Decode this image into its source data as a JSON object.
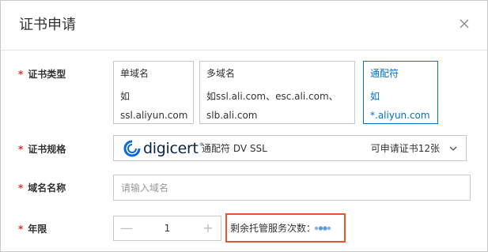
{
  "dialog": {
    "title": "证书申请",
    "close_icon": "close-icon"
  },
  "required_mark": "*",
  "cert_type": {
    "label": "证书类型",
    "options": [
      {
        "title": "单域名",
        "example": "如ssl.aliyun.com",
        "selected": false
      },
      {
        "title": "多域名",
        "example_line1": "如ssl.ali.com、esc.ali.com、",
        "example_line2": "slb.ali.com",
        "selected": false
      },
      {
        "title": "通配符",
        "example": "如*.aliyun.com",
        "selected": true
      }
    ]
  },
  "cert_spec": {
    "label": "证书规格",
    "brand": "digicert",
    "brand_tm": "®",
    "product": "通配符 DV SSL",
    "quota": "可申请证书12张",
    "dropdown_icon": "chevron-down-icon"
  },
  "domain_name": {
    "label": "域名名称",
    "value": "",
    "placeholder": "请输入域名"
  },
  "years": {
    "label": "年限",
    "value": "1",
    "minus": "—",
    "plus": "+"
  },
  "remaining": {
    "text": "剩余托管服务次数："
  },
  "colors": {
    "accent": "#0070cc",
    "required": "#d93026",
    "highlight": "#e2572c",
    "border": "#c8c8c8"
  }
}
